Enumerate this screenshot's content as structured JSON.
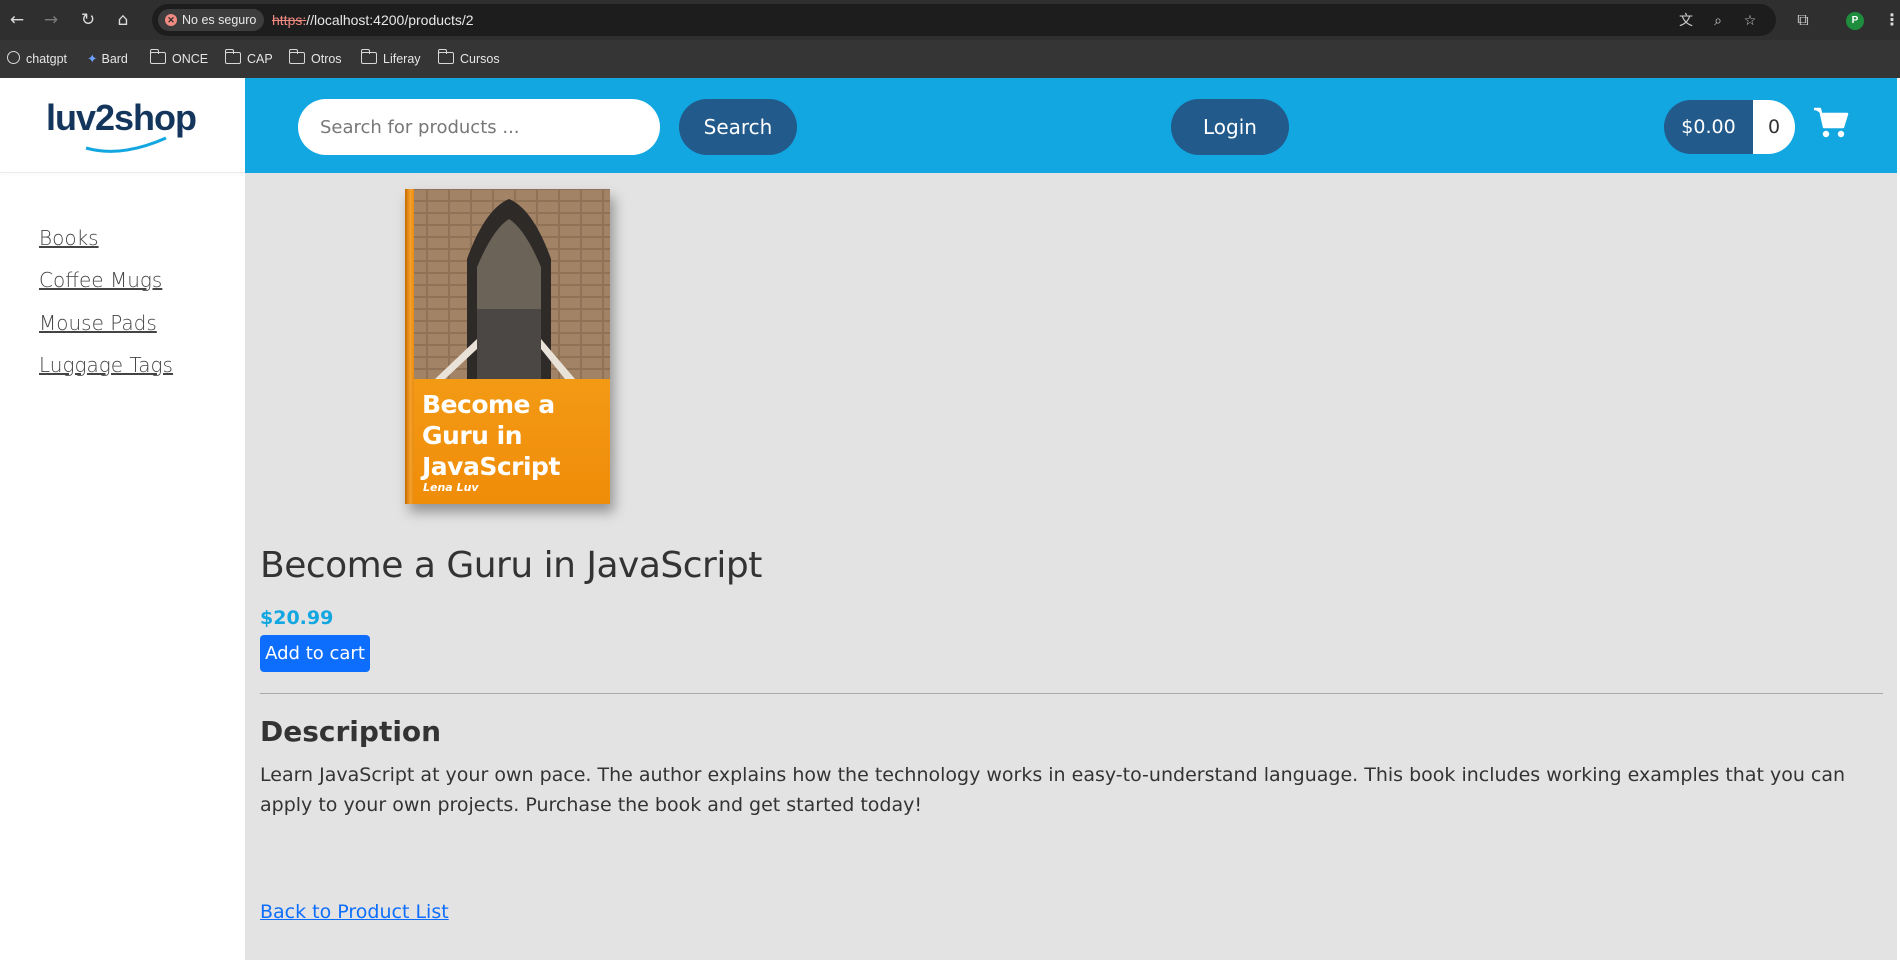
{
  "browser": {
    "security_chip": "No es seguro",
    "url_scheme": "https:",
    "url_rest": "//localhost:4200/products/2",
    "profile_initial": "P",
    "bookmarks": [
      "chatgpt",
      "Bard",
      "ONCE",
      "CAP",
      "Otros",
      "Liferay",
      "Cursos"
    ]
  },
  "app": {
    "logo_text": "luv2shop",
    "brand_color": "#12a7e1",
    "accent_dark": "#225a8b",
    "categories": [
      "Books",
      "Coffee Mugs",
      "Mouse Pads",
      "Luggage Tags"
    ]
  },
  "header": {
    "search_placeholder": "Search for products ...",
    "search_button": "Search",
    "login_button": "Login",
    "cart_total": "$0.00",
    "cart_quantity": "0",
    "cart_icon": "shopping-cart-icon"
  },
  "product": {
    "cover_title": "Become a Guru in JavaScript",
    "cover_author": "Lena Luv",
    "name": "Become a Guru in JavaScript",
    "price": "$20.99",
    "add_to_cart": "Add to cart",
    "description_heading": "Description",
    "description": "Learn JavaScript at your own pace. The author explains how the technology works in easy-to-understand language. This book includes working examples that you can apply to your own projects. Purchase the book and get started today!",
    "back_link": "Back to Product List"
  }
}
